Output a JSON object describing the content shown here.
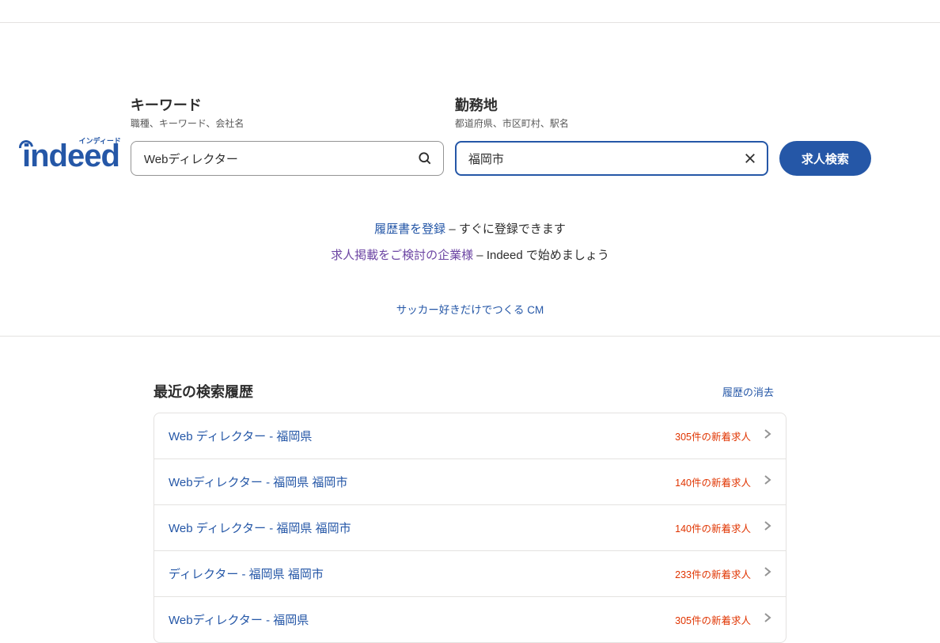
{
  "logo": {
    "text": "indeed",
    "subtitle": "インディード"
  },
  "search": {
    "keyword": {
      "label": "キーワード",
      "sublabel": "職種、キーワード、会社名",
      "value": "Webディレクター"
    },
    "location": {
      "label": "勤務地",
      "sublabel": "都道府県、市区町村、駅名",
      "value": "福岡市"
    },
    "button": "求人検索"
  },
  "promo": {
    "resume_link": "履歴書を登録",
    "resume_text": " – すぐに登録できます",
    "employer_link": "求人掲載をご検討の企業様",
    "employer_text": " – Indeed で始めましょう",
    "cm_link": "サッカー好きだけでつくる CM"
  },
  "recent": {
    "title": "最近の検索履歴",
    "clear": "履歴の消去",
    "items": [
      {
        "query": "Web ディレクター - 福岡県",
        "count": "305件の新着求人"
      },
      {
        "query": "Webディレクター - 福岡県 福岡市",
        "count": "140件の新着求人"
      },
      {
        "query": "Web ディレクター - 福岡県 福岡市",
        "count": "140件の新着求人"
      },
      {
        "query": "ディレクター - 福岡県 福岡市",
        "count": "233件の新着求人"
      },
      {
        "query": "Webディレクター - 福岡県",
        "count": "305件の新着求人"
      }
    ]
  }
}
